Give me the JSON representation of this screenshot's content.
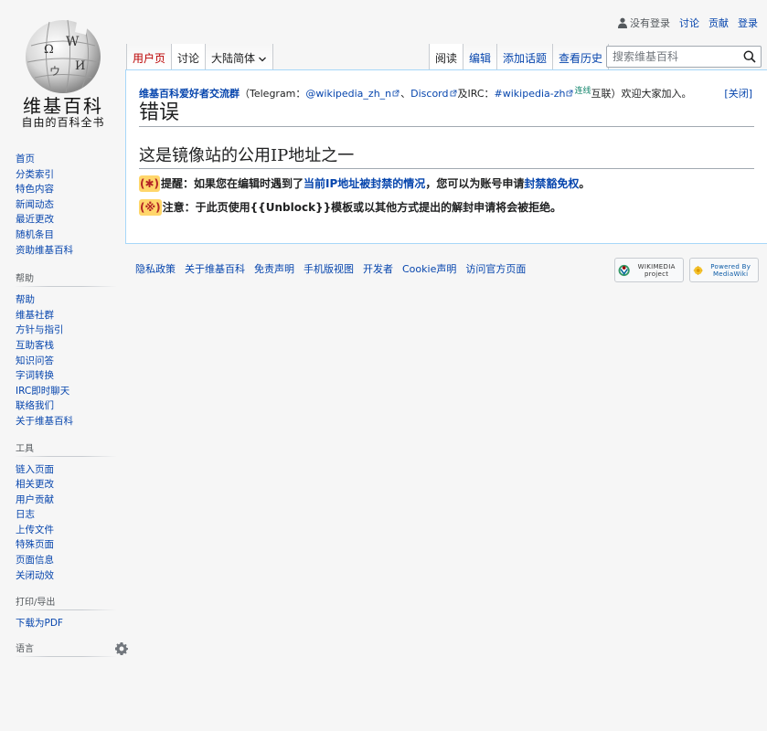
{
  "logo": {
    "wordmark": "维基百科",
    "tagline": "自由的百科全书"
  },
  "personal_tools": {
    "not_logged_in": "没有登录",
    "talk": "讨论",
    "contributions": "贡献",
    "login": "登录"
  },
  "left_tabs": {
    "user_page": "用户页",
    "talk": "讨论",
    "variant": "大陆简体"
  },
  "right_tabs": {
    "read": "阅读",
    "edit": "编辑",
    "add_topic": "添加话题",
    "history": "查看历史"
  },
  "search": {
    "placeholder": "搜索维基百科"
  },
  "sitenotice": {
    "group": "维基百科爱好者交流群",
    "open_paren": "（Telegram：",
    "telegram": "@wikipedia_zh_n",
    "sep1": "、",
    "discord": "Discord",
    "and_irc": "及IRC：",
    "irc": "#wikipedia-zh",
    "online": "连线",
    "rest": "互联）欢迎大家加入。",
    "close": "[关闭]"
  },
  "content": {
    "heading": "错误",
    "subheading": "这是镜像站的公用IP地址之一",
    "reminder_marker": "(✱)",
    "reminder_prefix": "提醒：如果您在编辑时遇到了",
    "reminder_link": "当前IP地址被封禁的情况",
    "reminder_middle": "，您可以为账号申请",
    "reminder_link2": "封禁豁免权",
    "reminder_end": "。",
    "note_marker": "(※)",
    "note_text": "注意：于此页使用{{Unblock}}模板或以其他方式提出的解封申请将会被拒绝。"
  },
  "sidebar": {
    "navigation": [
      "首页",
      "分类索引",
      "特色内容",
      "新闻动态",
      "最近更改",
      "随机条目",
      "资助维基百科"
    ],
    "help_heading": "帮助",
    "help": [
      "帮助",
      "维基社群",
      "方针与指引",
      "互助客栈",
      "知识问答",
      "字词转换",
      "IRC即时聊天",
      "联络我们",
      "关于维基百科"
    ],
    "tools_heading": "工具",
    "tools": [
      "链入页面",
      "相关更改",
      "用户贡献",
      "日志",
      "上传文件",
      "特殊页面",
      "页面信息",
      "关闭动效"
    ],
    "print_heading": "打印/导出",
    "print": [
      "下载为PDF"
    ],
    "lang_heading": "语言"
  },
  "footer": {
    "links": [
      "隐私政策",
      "关于维基百科",
      "免责声明",
      "手机版视图",
      "开发者",
      "Cookie声明",
      "访问官方页面"
    ],
    "wikimedia_badge": "WIKIMEDIA project",
    "mediawiki_badge": "Powered By MediaWiki"
  },
  "colors": {
    "link": "#0645ad",
    "new_link": "#ba0000",
    "content_border": "#a7d7f9",
    "marker_bg": "#ffd66b"
  }
}
